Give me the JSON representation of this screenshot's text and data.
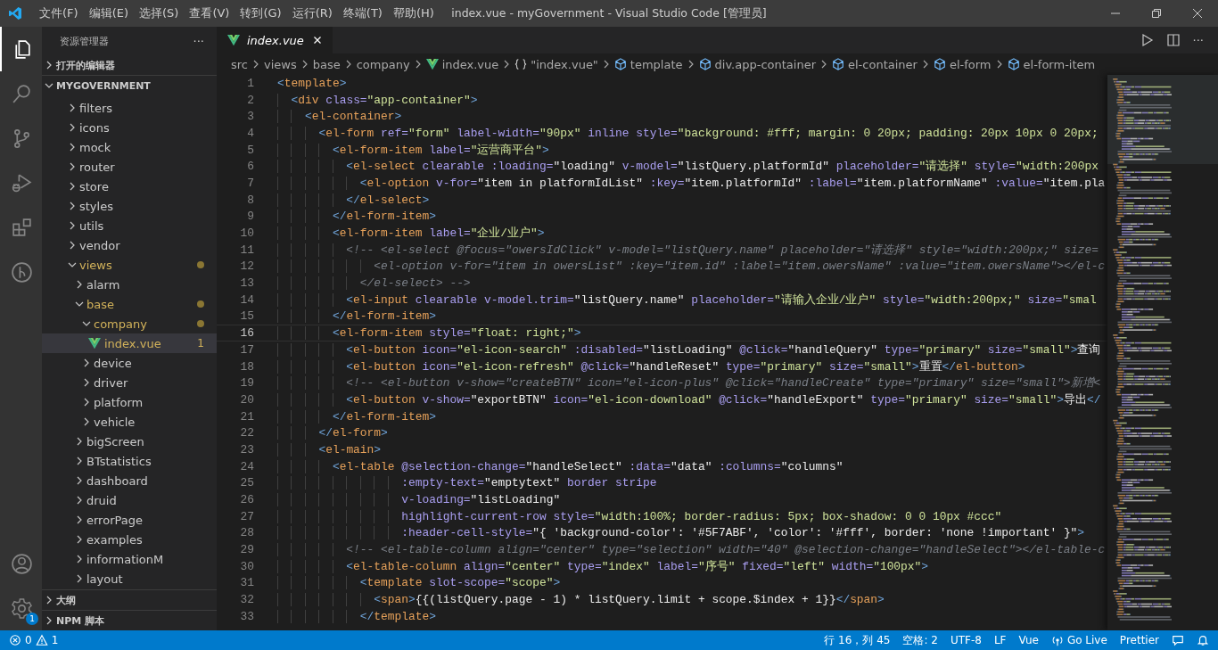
{
  "title_bar": {
    "menus": [
      "文件(F)",
      "编辑(E)",
      "选择(S)",
      "查看(V)",
      "转到(G)",
      "运行(R)",
      "终端(T)",
      "帮助(H)"
    ],
    "title": "index.vue - myGovernment - Visual Studio Code [管理员]"
  },
  "activity_bar": {
    "items": [
      {
        "kind": "files",
        "selected": true
      },
      {
        "kind": "search",
        "selected": false
      },
      {
        "kind": "source-control",
        "selected": false
      },
      {
        "kind": "run",
        "selected": false
      },
      {
        "kind": "extensions",
        "selected": false
      },
      {
        "kind": "branch-circle",
        "selected": false
      }
    ],
    "settings_badge": "1"
  },
  "sidebar": {
    "title": "资源管理器",
    "more": "···",
    "open_editors": {
      "label": "打开的编辑器",
      "expanded": false
    },
    "folder": {
      "label": "MYGOVERNMENT",
      "expanded": true,
      "tree": [
        {
          "label": "filters",
          "kind": "folder",
          "expanded": false,
          "modified": false,
          "selected": false
        },
        {
          "label": "icons",
          "kind": "folder",
          "expanded": false,
          "modified": false,
          "selected": false
        },
        {
          "label": "mock",
          "kind": "folder",
          "expanded": false,
          "modified": false,
          "selected": false
        },
        {
          "label": "router",
          "kind": "folder",
          "expanded": false,
          "modified": false,
          "selected": false
        },
        {
          "label": "store",
          "kind": "folder",
          "expanded": false,
          "modified": false,
          "selected": false
        },
        {
          "label": "styles",
          "kind": "folder",
          "expanded": false,
          "modified": false,
          "selected": false
        },
        {
          "label": "utils",
          "kind": "folder",
          "expanded": false,
          "modified": false,
          "selected": false
        },
        {
          "label": "vendor",
          "kind": "folder",
          "expanded": false,
          "modified": false,
          "selected": false
        },
        {
          "label": "views",
          "kind": "folder",
          "expanded": true,
          "modified": true,
          "selected": false,
          "children": [
            {
              "label": "alarm",
              "kind": "folder",
              "expanded": false,
              "modified": false,
              "selected": false
            },
            {
              "label": "base",
              "kind": "folder",
              "expanded": true,
              "modified": true,
              "selected": false,
              "children": [
                {
                  "label": "company",
                  "kind": "folder",
                  "expanded": true,
                  "modified": true,
                  "selected": false,
                  "children": [
                    {
                      "label": "index.vue",
                      "kind": "vue-file",
                      "modified": true,
                      "selected": true,
                      "problems": "1"
                    }
                  ]
                },
                {
                  "label": "device",
                  "kind": "folder",
                  "expanded": false,
                  "modified": false,
                  "selected": false
                },
                {
                  "label": "driver",
                  "kind": "folder",
                  "expanded": false,
                  "modified": false,
                  "selected": false
                },
                {
                  "label": "platform",
                  "kind": "folder",
                  "expanded": false,
                  "modified": false,
                  "selected": false
                },
                {
                  "label": "vehicle",
                  "kind": "folder",
                  "expanded": false,
                  "modified": false,
                  "selected": false
                }
              ]
            },
            {
              "label": "bigScreen",
              "kind": "folder",
              "expanded": false,
              "modified": false,
              "selected": false
            },
            {
              "label": "BTstatistics",
              "kind": "folder",
              "expanded": false,
              "modified": false,
              "selected": false
            },
            {
              "label": "dashboard",
              "kind": "folder",
              "expanded": false,
              "modified": false,
              "selected": false
            },
            {
              "label": "druid",
              "kind": "folder",
              "expanded": false,
              "modified": false,
              "selected": false
            },
            {
              "label": "errorPage",
              "kind": "folder",
              "expanded": false,
              "modified": false,
              "selected": false
            },
            {
              "label": "examples",
              "kind": "folder",
              "expanded": false,
              "modified": false,
              "selected": false
            },
            {
              "label": "informationM",
              "kind": "folder",
              "expanded": false,
              "modified": false,
              "selected": false
            },
            {
              "label": "layout",
              "kind": "folder",
              "expanded": false,
              "modified": false,
              "selected": false
            }
          ]
        }
      ]
    },
    "bottom_sections": [
      {
        "label": "大纲",
        "expanded": false
      },
      {
        "label": "NPM 脚本",
        "expanded": false
      }
    ]
  },
  "tabs": [
    {
      "label": "index.vue",
      "selected": true,
      "preview": true
    }
  ],
  "editor_actions": {
    "more": "···"
  },
  "breadcrumbs": [
    {
      "kind": "plain",
      "label": "src"
    },
    {
      "kind": "plain",
      "label": "views"
    },
    {
      "kind": "plain",
      "label": "base"
    },
    {
      "kind": "plain",
      "label": "company"
    },
    {
      "kind": "vue",
      "label": "index.vue"
    },
    {
      "kind": "object",
      "label": "\"index.vue\""
    },
    {
      "kind": "element",
      "label": "template"
    },
    {
      "kind": "element",
      "label": "div.app-container"
    },
    {
      "kind": "element",
      "label": "el-container"
    },
    {
      "kind": "element",
      "label": "el-form"
    },
    {
      "kind": "element",
      "label": "el-form-item"
    }
  ],
  "code": [
    {
      "n": "1",
      "current": false,
      "tokens": [
        {
          "kind": "bracket",
          "text": "<"
        },
        {
          "kind": "tag",
          "text": "template"
        },
        {
          "kind": "bracket",
          "text": ">"
        }
      ]
    },
    {
      "n": "2",
      "current": false,
      "tokens": [
        {
          "kind": "bracket",
          "text": "  <"
        },
        {
          "kind": "tag",
          "text": "div"
        },
        {
          "kind": "attr",
          "text": " class="
        },
        {
          "kind": "string",
          "text": "\"app-container\""
        },
        {
          "kind": "bracket",
          "text": ">"
        }
      ]
    },
    {
      "n": "3",
      "current": false,
      "tokens": [
        {
          "kind": "bracket",
          "text": "    <"
        },
        {
          "kind": "tag",
          "text": "el-container"
        },
        {
          "kind": "bracket",
          "text": ">"
        }
      ]
    },
    {
      "n": "4",
      "current": false,
      "tokens": [
        {
          "kind": "bracket",
          "text": "      <"
        },
        {
          "kind": "tag",
          "text": "el-form"
        },
        {
          "kind": "attr",
          "text": " ref="
        },
        {
          "kind": "string",
          "text": "\"form\""
        },
        {
          "kind": "attr",
          "text": " label-width="
        },
        {
          "kind": "string",
          "text": "\"90px\""
        },
        {
          "kind": "attr",
          "text": " inline style="
        },
        {
          "kind": "string",
          "text": "\"background: #fff; margin: 0 20px; padding: 20px 10px 0 20px;"
        }
      ]
    },
    {
      "n": "5",
      "current": false,
      "tokens": [
        {
          "kind": "bracket",
          "text": "        <"
        },
        {
          "kind": "tag",
          "text": "el-form-item"
        },
        {
          "kind": "attr",
          "text": " label="
        },
        {
          "kind": "string",
          "text": "\"运营商平台\""
        },
        {
          "kind": "bracket",
          "text": ">"
        }
      ]
    },
    {
      "n": "6",
      "current": false,
      "tokens": [
        {
          "kind": "bracket",
          "text": "          <"
        },
        {
          "kind": "tag",
          "text": "el-select"
        },
        {
          "kind": "attr",
          "text": " clearable :loading="
        },
        {
          "kind": "expr",
          "text": "\"loading\""
        },
        {
          "kind": "attr",
          "text": " v-model="
        },
        {
          "kind": "expr",
          "text": "\"listQuery.platformId\""
        },
        {
          "kind": "attr",
          "text": " placeholder="
        },
        {
          "kind": "string",
          "text": "\"请选择\""
        },
        {
          "kind": "attr",
          "text": " style="
        },
        {
          "kind": "string",
          "text": "\"width:200px"
        }
      ]
    },
    {
      "n": "7",
      "current": false,
      "tokens": [
        {
          "kind": "bracket",
          "text": "            <"
        },
        {
          "kind": "tag",
          "text": "el-option"
        },
        {
          "kind": "attr",
          "text": " v-for="
        },
        {
          "kind": "expr",
          "text": "\"item in platformIdList\""
        },
        {
          "kind": "attr",
          "text": " :key="
        },
        {
          "kind": "expr",
          "text": "\"item.platformId\""
        },
        {
          "kind": "attr",
          "text": " :label="
        },
        {
          "kind": "expr",
          "text": "\"item.platformName\""
        },
        {
          "kind": "attr",
          "text": " :value="
        },
        {
          "kind": "expr",
          "text": "\"item.pla"
        }
      ]
    },
    {
      "n": "8",
      "current": false,
      "tokens": [
        {
          "kind": "bracket",
          "text": "          </"
        },
        {
          "kind": "tag",
          "text": "el-select"
        },
        {
          "kind": "bracket",
          "text": ">"
        }
      ]
    },
    {
      "n": "9",
      "current": false,
      "tokens": [
        {
          "kind": "bracket",
          "text": "        </"
        },
        {
          "kind": "tag",
          "text": "el-form-item"
        },
        {
          "kind": "bracket",
          "text": ">"
        }
      ]
    },
    {
      "n": "10",
      "current": false,
      "tokens": [
        {
          "kind": "bracket",
          "text": "        <"
        },
        {
          "kind": "tag",
          "text": "el-form-item"
        },
        {
          "kind": "attr",
          "text": " label="
        },
        {
          "kind": "string",
          "text": "\"企业/业户\""
        },
        {
          "kind": "bracket",
          "text": ">"
        }
      ]
    },
    {
      "n": "11",
      "current": false,
      "tokens": [
        {
          "kind": "comment",
          "text": "          <!-- <el-select @focus=\"owersIdClick\" v-model=\"listQuery.name\" placeholder=\"请选择\" style=\"width:200px;\" size="
        }
      ]
    },
    {
      "n": "12",
      "current": false,
      "tokens": [
        {
          "kind": "comment",
          "text": "              <el-option v-for=\"item in owersList\" :key=\"item.id\" :label=\"item.owersName\" :value=\"item.owersName\"></el-c"
        }
      ]
    },
    {
      "n": "13",
      "current": false,
      "tokens": [
        {
          "kind": "comment",
          "text": "            </el-select> -->"
        }
      ]
    },
    {
      "n": "14",
      "current": false,
      "tokens": [
        {
          "kind": "bracket",
          "text": "          <"
        },
        {
          "kind": "tag",
          "text": "el-input"
        },
        {
          "kind": "attr",
          "text": " clearable v-model.trim="
        },
        {
          "kind": "expr",
          "text": "\"listQuery.name\""
        },
        {
          "kind": "attr",
          "text": " placeholder="
        },
        {
          "kind": "string",
          "text": "\"请输入企业/业户\""
        },
        {
          "kind": "attr",
          "text": " style="
        },
        {
          "kind": "string",
          "text": "\"width:200px;\""
        },
        {
          "kind": "attr",
          "text": " size="
        },
        {
          "kind": "string",
          "text": "\"smal"
        }
      ]
    },
    {
      "n": "15",
      "current": false,
      "tokens": [
        {
          "kind": "bracket",
          "text": "        </"
        },
        {
          "kind": "tag",
          "text": "el-form-item"
        },
        {
          "kind": "bracket",
          "text": ">"
        }
      ]
    },
    {
      "n": "16",
      "current": true,
      "tokens": [
        {
          "kind": "bracket",
          "text": "        <"
        },
        {
          "kind": "tag",
          "text": "el-form-item"
        },
        {
          "kind": "attr",
          "text": " style="
        },
        {
          "kind": "string",
          "text": "\"float: right;\""
        },
        {
          "kind": "bracket",
          "text": ">"
        }
      ]
    },
    {
      "n": "17",
      "current": false,
      "tokens": [
        {
          "kind": "bracket",
          "text": "          <"
        },
        {
          "kind": "tag",
          "text": "el-button"
        },
        {
          "kind": "attr",
          "text": " icon="
        },
        {
          "kind": "string",
          "text": "\"el-icon-search\""
        },
        {
          "kind": "attr",
          "text": " :disabled="
        },
        {
          "kind": "expr",
          "text": "\"listLoading\""
        },
        {
          "kind": "attr",
          "text": " @click="
        },
        {
          "kind": "expr",
          "text": "\"handleQuery\""
        },
        {
          "kind": "attr",
          "text": " type="
        },
        {
          "kind": "string",
          "text": "\"primary\""
        },
        {
          "kind": "attr",
          "text": " size="
        },
        {
          "kind": "string",
          "text": "\"small\""
        },
        {
          "kind": "bracket",
          "text": ">"
        },
        {
          "kind": "expr",
          "text": "查询"
        }
      ]
    },
    {
      "n": "18",
      "current": false,
      "tokens": [
        {
          "kind": "bracket",
          "text": "          <"
        },
        {
          "kind": "tag",
          "text": "el-button"
        },
        {
          "kind": "attr",
          "text": " icon="
        },
        {
          "kind": "string",
          "text": "\"el-icon-refresh\""
        },
        {
          "kind": "attr",
          "text": " @click="
        },
        {
          "kind": "expr",
          "text": "\"handleReset\""
        },
        {
          "kind": "attr",
          "text": " type="
        },
        {
          "kind": "string",
          "text": "\"primary\""
        },
        {
          "kind": "attr",
          "text": " size="
        },
        {
          "kind": "string",
          "text": "\"small\""
        },
        {
          "kind": "bracket",
          "text": ">"
        },
        {
          "kind": "expr",
          "text": "重置"
        },
        {
          "kind": "bracket",
          "text": "</"
        },
        {
          "kind": "tag",
          "text": "el-button"
        },
        {
          "kind": "bracket",
          "text": ">"
        }
      ]
    },
    {
      "n": "19",
      "current": false,
      "tokens": [
        {
          "kind": "comment",
          "text": "          <!-- <el-button v-show=\"createBTN\" icon=\"el-icon-plus\" @click=\"handleCreate\" type=\"primary\" size=\"small\">新增<"
        }
      ]
    },
    {
      "n": "20",
      "current": false,
      "tokens": [
        {
          "kind": "bracket",
          "text": "          <"
        },
        {
          "kind": "tag",
          "text": "el-button"
        },
        {
          "kind": "attr",
          "text": " v-show="
        },
        {
          "kind": "expr",
          "text": "\"exportBTN\""
        },
        {
          "kind": "attr",
          "text": " icon="
        },
        {
          "kind": "string",
          "text": "\"el-icon-download\""
        },
        {
          "kind": "attr",
          "text": " @click="
        },
        {
          "kind": "expr",
          "text": "\"handleExport\""
        },
        {
          "kind": "attr",
          "text": " type="
        },
        {
          "kind": "string",
          "text": "\"primary\""
        },
        {
          "kind": "attr",
          "text": " size="
        },
        {
          "kind": "string",
          "text": "\"small\""
        },
        {
          "kind": "bracket",
          "text": ">"
        },
        {
          "kind": "expr",
          "text": "导出"
        },
        {
          "kind": "bracket",
          "text": "</"
        }
      ]
    },
    {
      "n": "21",
      "current": false,
      "tokens": [
        {
          "kind": "bracket",
          "text": "        </"
        },
        {
          "kind": "tag",
          "text": "el-form-item"
        },
        {
          "kind": "bracket",
          "text": ">"
        }
      ]
    },
    {
      "n": "22",
      "current": false,
      "tokens": [
        {
          "kind": "bracket",
          "text": "      </"
        },
        {
          "kind": "tag",
          "text": "el-form"
        },
        {
          "kind": "bracket",
          "text": ">"
        }
      ]
    },
    {
      "n": "23",
      "current": false,
      "tokens": [
        {
          "kind": "bracket",
          "text": "      <"
        },
        {
          "kind": "tag",
          "text": "el-main"
        },
        {
          "kind": "bracket",
          "text": ">"
        }
      ]
    },
    {
      "n": "24",
      "current": false,
      "tokens": [
        {
          "kind": "bracket",
          "text": "        <"
        },
        {
          "kind": "tag",
          "text": "el-table"
        },
        {
          "kind": "attr",
          "text": " @selection-change="
        },
        {
          "kind": "expr",
          "text": "\"handleSelect\""
        },
        {
          "kind": "attr",
          "text": " :data="
        },
        {
          "kind": "expr",
          "text": "\"data\""
        },
        {
          "kind": "attr",
          "text": " :columns="
        },
        {
          "kind": "expr",
          "text": "\"columns\""
        }
      ]
    },
    {
      "n": "25",
      "current": false,
      "tokens": [
        {
          "kind": "attr",
          "text": "                  :empty-text="
        },
        {
          "kind": "expr",
          "text": "\"emptytext\""
        },
        {
          "kind": "attr",
          "text": " border stripe"
        }
      ]
    },
    {
      "n": "26",
      "current": false,
      "tokens": [
        {
          "kind": "attr",
          "text": "                  v-loading="
        },
        {
          "kind": "expr",
          "text": "\"listLoading\""
        }
      ]
    },
    {
      "n": "27",
      "current": false,
      "tokens": [
        {
          "kind": "attr",
          "text": "                  highlight-current-row style="
        },
        {
          "kind": "string",
          "text": "\"width:100%; border-radius: 5px; box-shadow: 0 0 10px #ccc\""
        }
      ]
    },
    {
      "n": "28",
      "current": false,
      "tokens": [
        {
          "kind": "attr",
          "text": "                  :header-cell-style="
        },
        {
          "kind": "expr",
          "text": "\"{ 'background-color': '#5F7ABF', 'color': '#fff', border: 'none !important' }\""
        },
        {
          "kind": "bracket",
          "text": ">"
        }
      ]
    },
    {
      "n": "29",
      "current": false,
      "tokens": [
        {
          "kind": "comment",
          "text": "          <!-- <el-table-column align=\"center\" type=\"selection\" width=\"40\" @selection-change=\"handleSelect\"></el-table-c"
        }
      ]
    },
    {
      "n": "30",
      "current": false,
      "tokens": [
        {
          "kind": "bracket",
          "text": "          <"
        },
        {
          "kind": "tag",
          "text": "el-table-column"
        },
        {
          "kind": "attr",
          "text": " align="
        },
        {
          "kind": "string",
          "text": "\"center\""
        },
        {
          "kind": "attr",
          "text": " type="
        },
        {
          "kind": "string",
          "text": "\"index\""
        },
        {
          "kind": "attr",
          "text": " label="
        },
        {
          "kind": "string",
          "text": "\"序号\""
        },
        {
          "kind": "attr",
          "text": " fixed="
        },
        {
          "kind": "string",
          "text": "\"left\""
        },
        {
          "kind": "attr",
          "text": " width="
        },
        {
          "kind": "string",
          "text": "\"100px\""
        },
        {
          "kind": "bracket",
          "text": ">"
        }
      ]
    },
    {
      "n": "31",
      "current": false,
      "tokens": [
        {
          "kind": "bracket",
          "text": "            <"
        },
        {
          "kind": "tag",
          "text": "template"
        },
        {
          "kind": "attr",
          "text": " slot-scope="
        },
        {
          "kind": "string",
          "text": "\"scope\""
        },
        {
          "kind": "bracket",
          "text": ">"
        }
      ]
    },
    {
      "n": "32",
      "current": false,
      "tokens": [
        {
          "kind": "bracket",
          "text": "              <"
        },
        {
          "kind": "tag",
          "text": "span"
        },
        {
          "kind": "bracket",
          "text": ">"
        },
        {
          "kind": "expr",
          "text": "{{(listQuery.page - 1) * listQuery.limit + scope.$index + 1}}"
        },
        {
          "kind": "bracket",
          "text": "</"
        },
        {
          "kind": "tag",
          "text": "span"
        },
        {
          "kind": "bracket",
          "text": ">"
        }
      ]
    },
    {
      "n": "33",
      "current": false,
      "tokens": [
        {
          "kind": "bracket",
          "text": "            </"
        },
        {
          "kind": "tag",
          "text": "template"
        },
        {
          "kind": "bracket",
          "text": ">"
        }
      ]
    }
  ],
  "status_bar": {
    "errors": "0",
    "warnings": "1",
    "items": [
      {
        "kind": "text",
        "label": "行 16，列 45"
      },
      {
        "kind": "text",
        "label": "空格: 2"
      },
      {
        "kind": "text",
        "label": "UTF-8"
      },
      {
        "kind": "text",
        "label": "LF"
      },
      {
        "kind": "text",
        "label": "Vue"
      },
      {
        "kind": "go-live",
        "label": "Go Live"
      },
      {
        "kind": "text",
        "label": "Prettier"
      },
      {
        "kind": "feedback"
      },
      {
        "kind": "bell"
      }
    ]
  }
}
